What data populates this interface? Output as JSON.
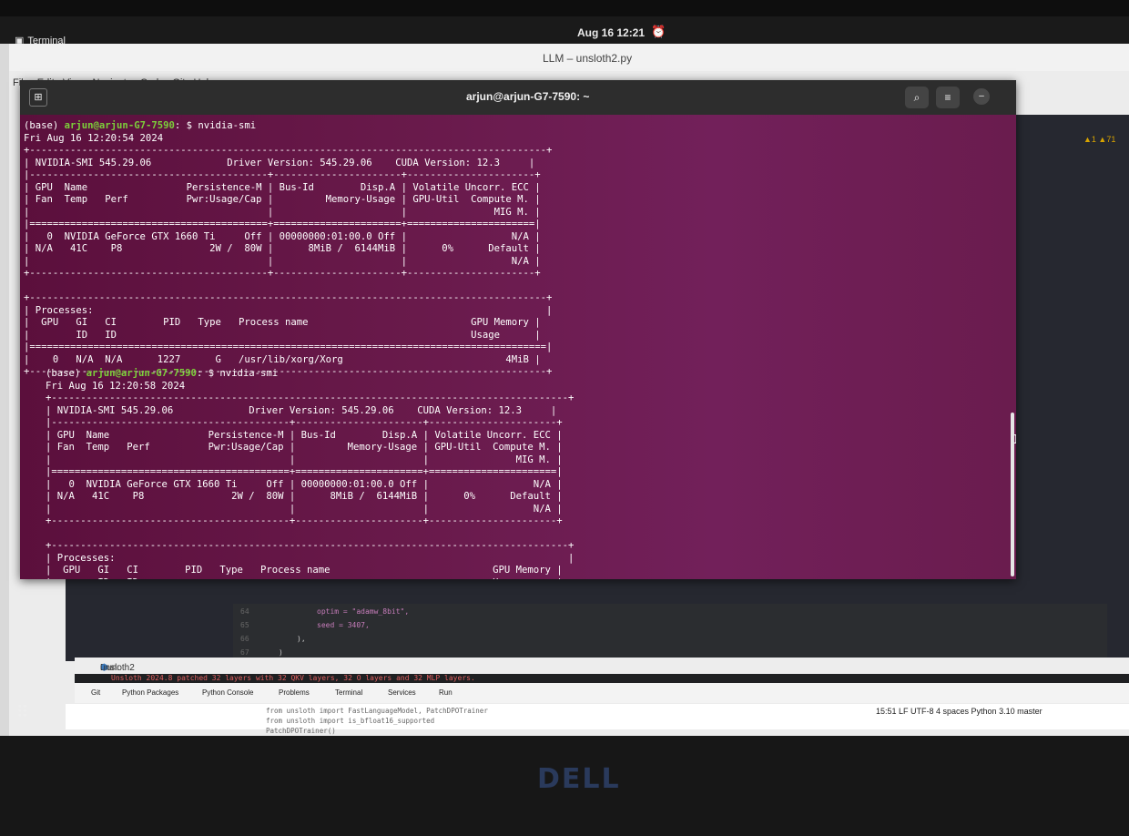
{
  "topbar": {
    "app_name": "Terminal",
    "clock": "Aug 16  12:21"
  },
  "ide": {
    "window_title": "LLM – unsloth2.py",
    "menu": [
      "File",
      "Edit",
      "View",
      "Navigate",
      "Code",
      "Git",
      "Help"
    ],
    "warnings": "▲1  ▲71",
    "editor_lines": [
      {
        "num": "64",
        "code": "optim = \"adamw_8bit\","
      },
      {
        "num": "65",
        "code": "seed = 3407,"
      },
      {
        "num": "66",
        "code": "),"
      },
      {
        "num": "67",
        "code": ")"
      }
    ],
    "run_label": "Run:",
    "run_config": "unsloth2",
    "run_output": "Unsloth 2024.8 patched 32 layers with 32 QKV layers, 32 O layers and 32 MLP layers.",
    "tool_tabs": [
      "Git",
      "Python Packages",
      "Python Console",
      "Problems",
      "Terminal",
      "Services",
      "Run"
    ],
    "code_preview": [
      "from unsloth import FastLanguageModel, PatchDPOTrainer",
      "from unsloth import is_bfloat16_supported",
      "PatchDPOTrainer()"
    ],
    "status": "15:51  LF  UTF-8  4 spaces  Python 3.10  master"
  },
  "terminal": {
    "title": "arjun@arjun-G7-7590: ~",
    "sessions": [
      {
        "prompt_prefix": "(base) ",
        "prompt_user": "arjun@arjun-G7-7590",
        "prompt_suffix": ": $ nvidia-smi",
        "output": "Fri Aug 16 12:20:54 2024\n+-----------------------------------------------------------------------------------------+\n| NVIDIA-SMI 545.29.06             Driver Version: 545.29.06    CUDA Version: 12.3     |\n|-----------------------------------------+----------------------+----------------------+\n| GPU  Name                 Persistence-M | Bus-Id        Disp.A | Volatile Uncorr. ECC |\n| Fan  Temp   Perf          Pwr:Usage/Cap |         Memory-Usage | GPU-Util  Compute M. |\n|                                         |                      |               MIG M. |\n|=========================================+======================+======================|\n|   0  NVIDIA GeForce GTX 1660 Ti     Off | 00000000:01:00.0 Off |                  N/A |\n| N/A   41C    P8               2W /  80W |      8MiB /  6144MiB |      0%      Default |\n|                                         |                      |                  N/A |\n+-----------------------------------------+----------------------+----------------------+\n\n+-----------------------------------------------------------------------------------------+\n| Processes:                                                                              |\n|  GPU   GI   CI        PID   Type   Process name                            GPU Memory |\n|        ID   ID                                                             Usage      |\n|=========================================================================================|\n|    0   N/A  N/A      1227      G   /usr/lib/xorg/Xorg                            4MiB |\n+-----------------------------------------------------------------------------------------+"
      },
      {
        "prompt_prefix": "(base) ",
        "prompt_user": "arjun@arjun-G7-7590",
        "prompt_suffix": ": $ nvidia-smi",
        "output": "Fri Aug 16 12:20:58 2024\n+-----------------------------------------------------------------------------------------+\n| NVIDIA-SMI 545.29.06             Driver Version: 545.29.06    CUDA Version: 12.3     |\n|-----------------------------------------+----------------------+----------------------+\n| GPU  Name                 Persistence-M | Bus-Id        Disp.A | Volatile Uncorr. ECC |\n| Fan  Temp   Perf          Pwr:Usage/Cap |         Memory-Usage | GPU-Util  Compute M. |\n|                                         |                      |               MIG M. |\n|=========================================+======================+======================|\n|   0  NVIDIA GeForce GTX 1660 Ti     Off | 00000000:01:00.0 Off |                  N/A |\n| N/A   41C    P8               2W /  80W |      8MiB /  6144MiB |      0%      Default |\n|                                         |                      |                  N/A |\n+-----------------------------------------+----------------------+----------------------+\n\n+-----------------------------------------------------------------------------------------+\n| Processes:                                                                              |\n|  GPU   GI   CI        PID   Type   Process name                            GPU Memory |\n|        ID   ID                                                             Usage      |"
      }
    ]
  },
  "brand": "DELL"
}
